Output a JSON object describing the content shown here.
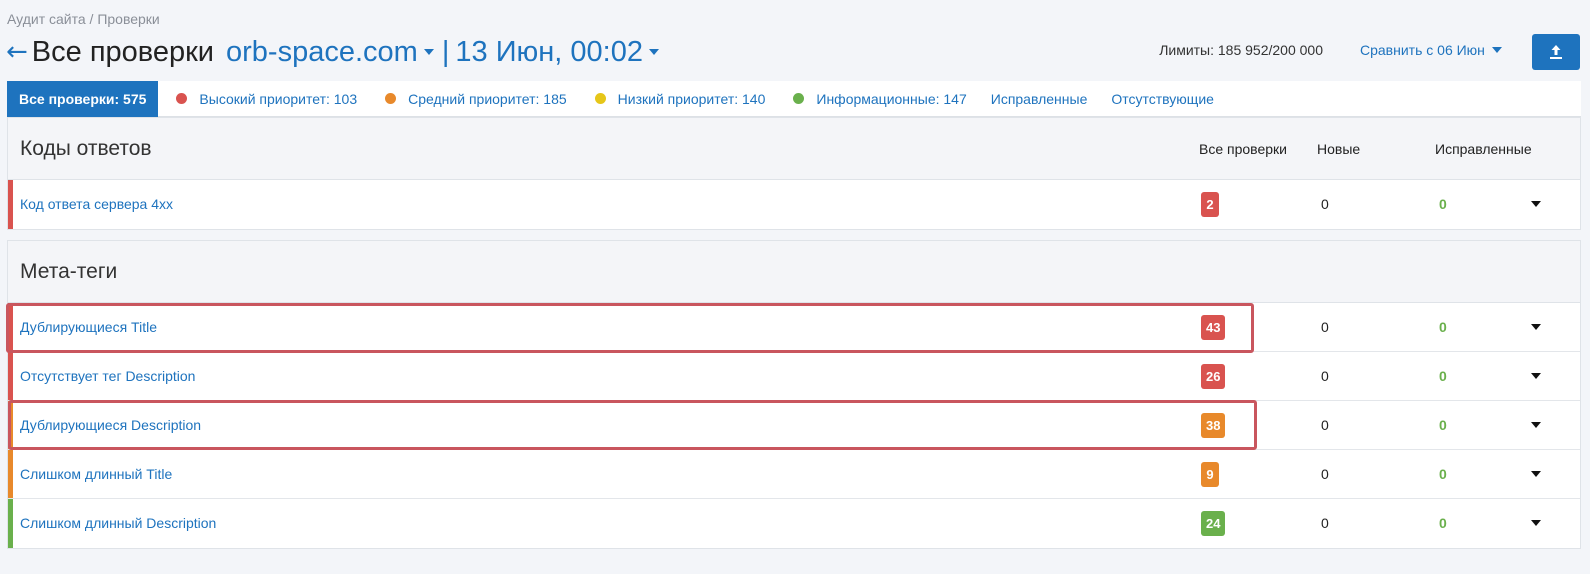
{
  "breadcrumb": "Аудит сайта / Проверки",
  "header": {
    "title": "Все проверки",
    "site": "orb-space.com",
    "separator": "|",
    "date": "13 Июн, 00:02"
  },
  "limits": "Лимиты: 185 952/200 000",
  "compare_label": "Сравнить с 06 Июн",
  "tabs": [
    {
      "label": "Все проверки: 575",
      "active": true
    },
    {
      "label": "Высокий приоритет: 103",
      "dot": "#d9534f"
    },
    {
      "label": "Средний приоритет: 185",
      "dot": "#e8892b"
    },
    {
      "label": "Низкий приоритет: 140",
      "dot": "#e6c619"
    },
    {
      "label": "Информационные: 147",
      "dot": "#6ab04c"
    },
    {
      "label": "Исправленные"
    },
    {
      "label": "Отсутствующие"
    }
  ],
  "columns": {
    "all": "Все проверки",
    "new": "Новые",
    "fixed": "Исправленные"
  },
  "colors": {
    "high": "#d9534f",
    "medium": "#e8892b",
    "low": "#e6c619",
    "info": "#6ab04c",
    "accent": "#1e73be"
  },
  "sections": [
    {
      "title": "Коды ответов",
      "rows": [
        {
          "label": "Код ответа сервера 4xx",
          "count": "2",
          "new": "0",
          "fixed": "0",
          "priority": "high"
        }
      ]
    },
    {
      "title": "Мета-теги",
      "rows": [
        {
          "label": "Дублирующиеся Title",
          "count": "43",
          "new": "0",
          "fixed": "0",
          "priority": "high"
        },
        {
          "label": "Отсутствует тег Description",
          "count": "26",
          "new": "0",
          "fixed": "0",
          "priority": "high"
        },
        {
          "label": "Дублирующиеся Description",
          "count": "38",
          "new": "0",
          "fixed": "0",
          "priority": "medium"
        },
        {
          "label": "Слишком длинный Title",
          "count": "9",
          "new": "0",
          "fixed": "0",
          "priority": "medium"
        },
        {
          "label": "Слишком длинный Description",
          "count": "24",
          "new": "0",
          "fixed": "0",
          "priority": "info"
        }
      ]
    }
  ]
}
